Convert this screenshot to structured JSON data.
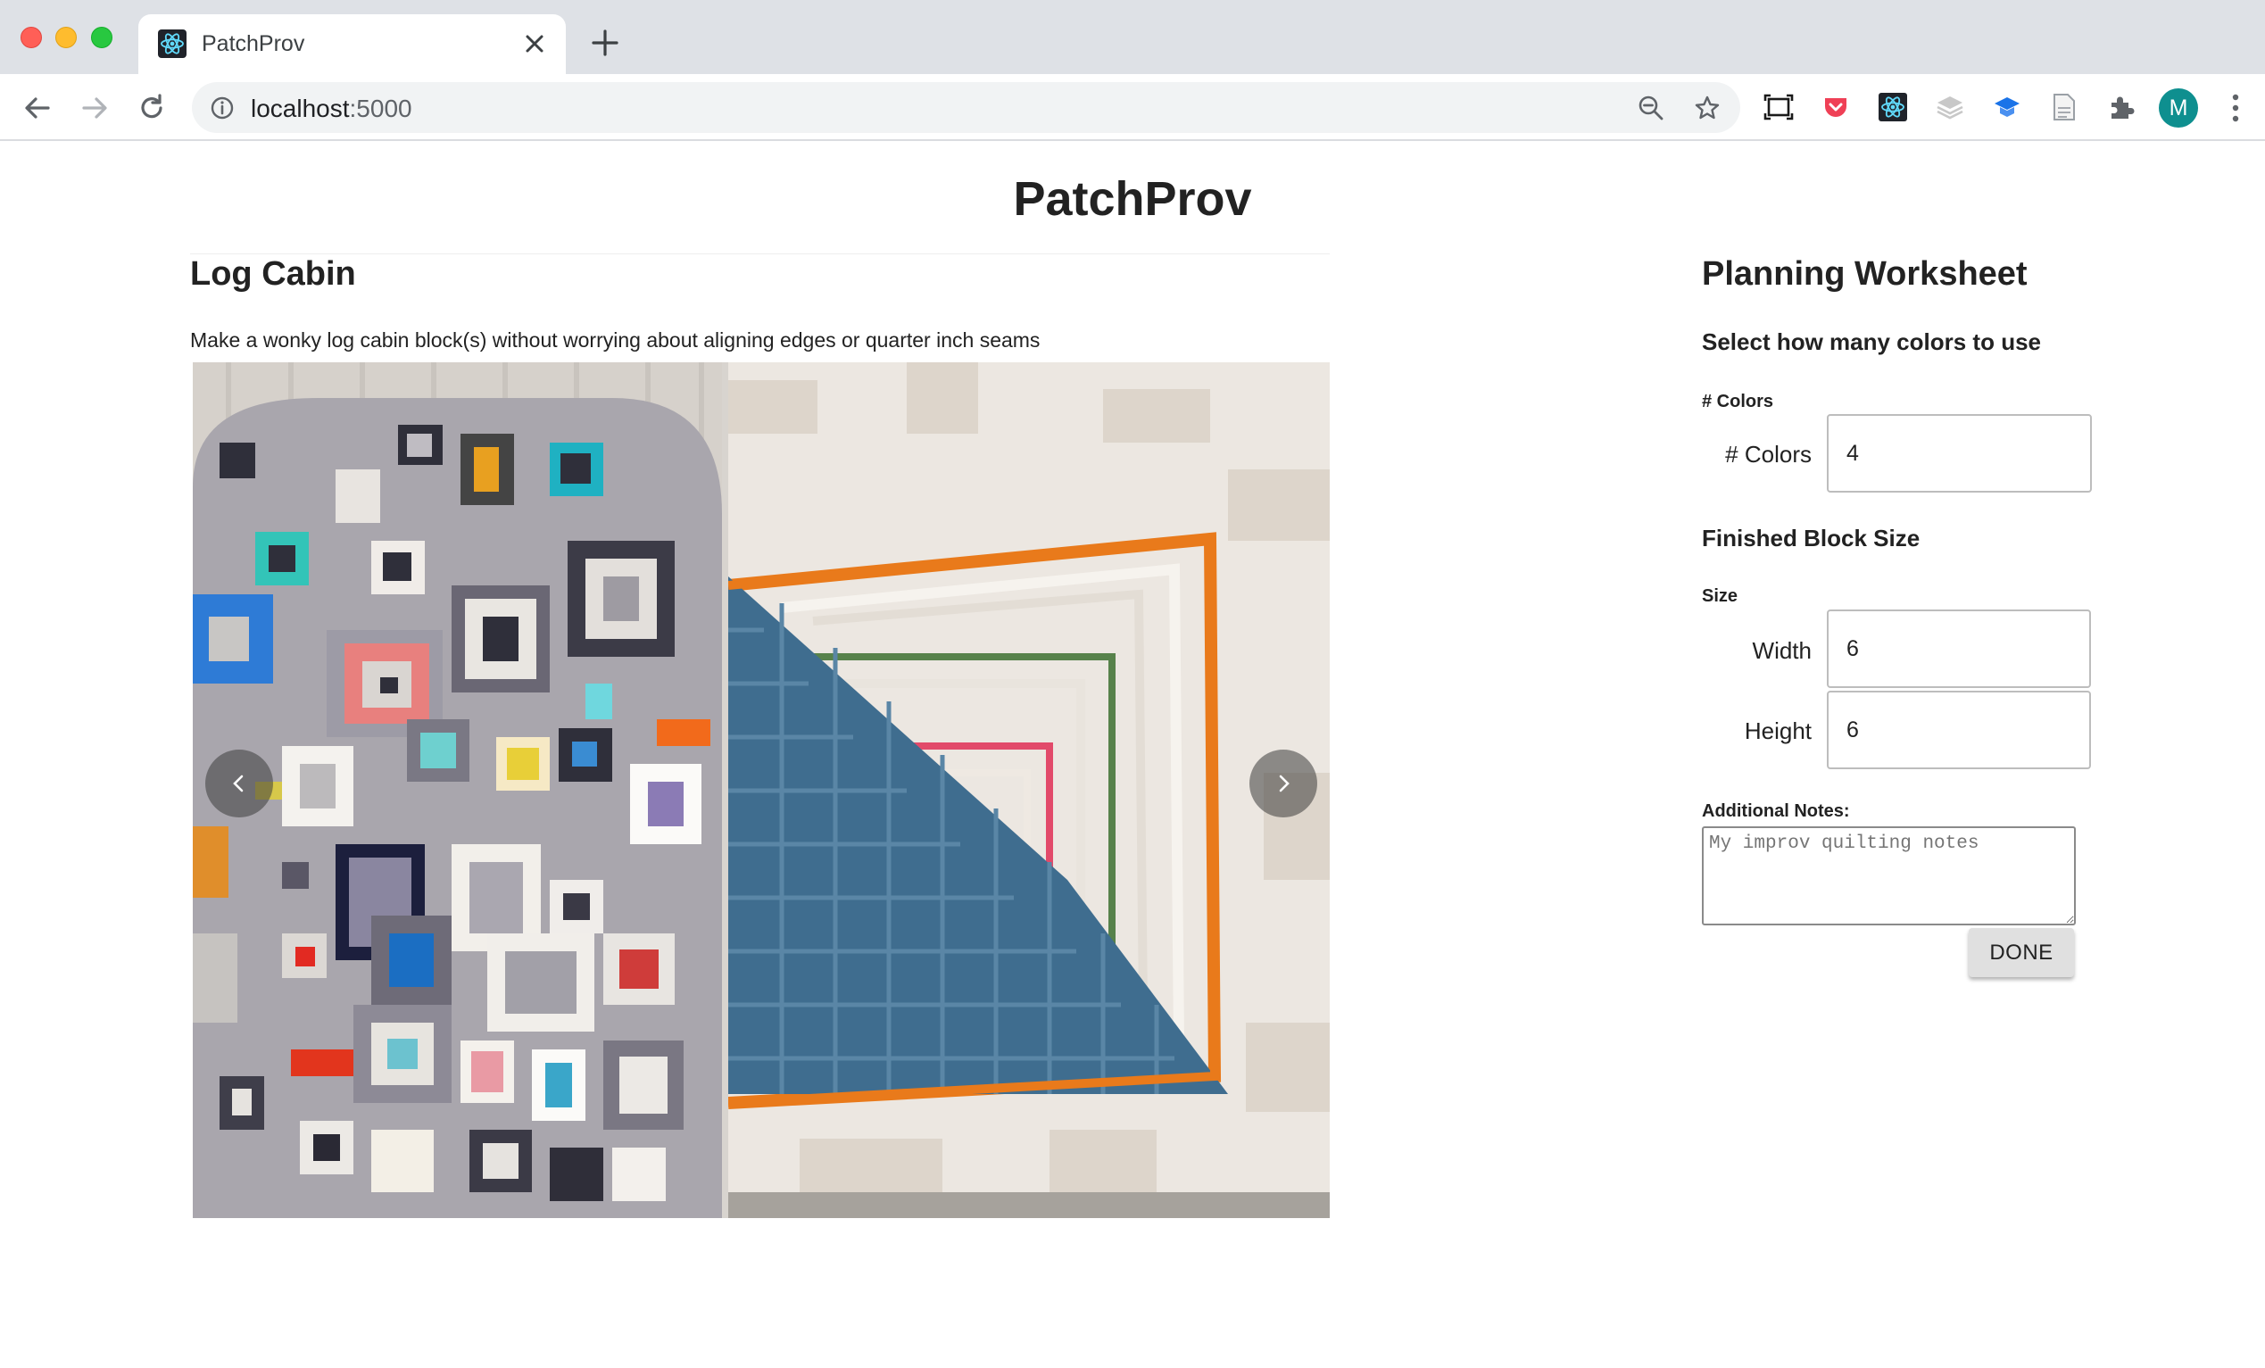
{
  "browser": {
    "tab_title": "PatchProv",
    "url_host": "localhost",
    "url_port": ":5000",
    "avatar_letter": "M"
  },
  "page": {
    "title": "PatchProv"
  },
  "pattern": {
    "name": "Log Cabin",
    "description": "Make a wonky log cabin block(s) without worrying about aligning edges or quarter inch seams"
  },
  "worksheet": {
    "title": "Planning Worksheet",
    "colors_heading": "Select how many colors to use",
    "colors_group_label": "# Colors",
    "colors_field_label": "# Colors",
    "colors_value": "4",
    "size_heading": "Finished Block Size",
    "size_group_label": "Size",
    "width_label": "Width",
    "width_value": "6",
    "height_label": "Height",
    "height_value": "6",
    "notes_label": "Additional Notes:",
    "notes_placeholder": "My improv quilting notes",
    "done_label": "DONE"
  },
  "icons": {
    "favicon": "react-atom-icon",
    "back": "arrow-left-icon",
    "forward": "arrow-right-icon",
    "reload": "reload-icon",
    "zoom": "zoom-out-icon",
    "bookmark": "star-icon",
    "prev": "chevron-left-icon",
    "next": "chevron-right-icon"
  },
  "colors": {
    "tabstrip": "#dee1e6",
    "omnibox": "#f1f3f4",
    "avatar": "#0e8f8f",
    "done_button": "#e0e0e0"
  }
}
